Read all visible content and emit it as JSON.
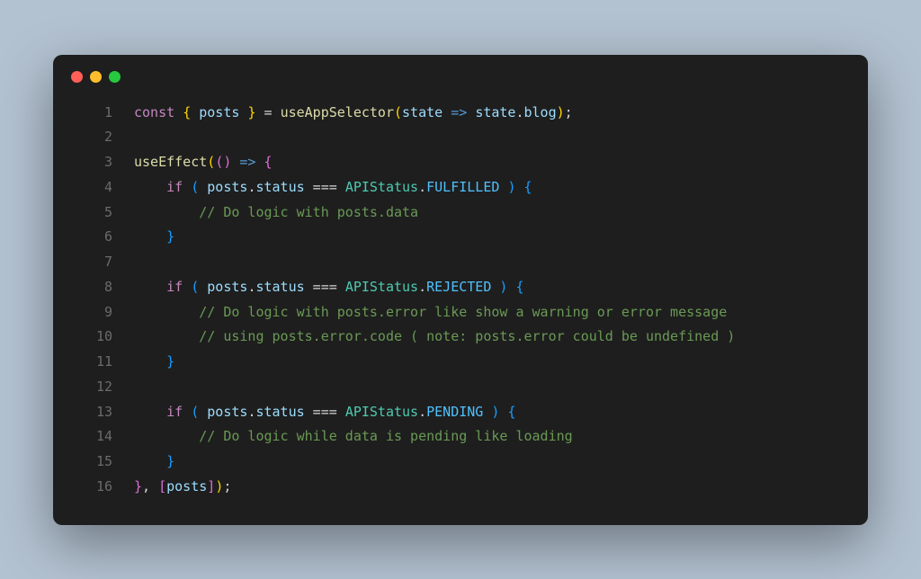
{
  "code": {
    "lines": [
      {
        "n": "1",
        "tokens": [
          {
            "t": "kw",
            "v": "const"
          },
          {
            "t": "punc",
            "v": " "
          },
          {
            "t": "brace",
            "v": "{"
          },
          {
            "t": "punc",
            "v": " "
          },
          {
            "t": "var",
            "v": "posts"
          },
          {
            "t": "punc",
            "v": " "
          },
          {
            "t": "brace",
            "v": "}"
          },
          {
            "t": "punc",
            "v": " = "
          },
          {
            "t": "fn",
            "v": "useAppSelector"
          },
          {
            "t": "brace",
            "v": "("
          },
          {
            "t": "var",
            "v": "state"
          },
          {
            "t": "punc",
            "v": " "
          },
          {
            "t": "arrow",
            "v": "=>"
          },
          {
            "t": "punc",
            "v": " "
          },
          {
            "t": "var",
            "v": "state"
          },
          {
            "t": "punc",
            "v": "."
          },
          {
            "t": "prop",
            "v": "blog"
          },
          {
            "t": "brace",
            "v": ")"
          },
          {
            "t": "punc",
            "v": ";"
          }
        ]
      },
      {
        "n": "2",
        "tokens": []
      },
      {
        "n": "3",
        "tokens": [
          {
            "t": "fn",
            "v": "useEffect"
          },
          {
            "t": "brace",
            "v": "("
          },
          {
            "t": "brace2",
            "v": "()"
          },
          {
            "t": "punc",
            "v": " "
          },
          {
            "t": "arrow",
            "v": "=>"
          },
          {
            "t": "punc",
            "v": " "
          },
          {
            "t": "brace2",
            "v": "{"
          }
        ]
      },
      {
        "n": "4",
        "tokens": [
          {
            "t": "punc",
            "v": "    "
          },
          {
            "t": "kw",
            "v": "if"
          },
          {
            "t": "punc",
            "v": " "
          },
          {
            "t": "brace3",
            "v": "("
          },
          {
            "t": "punc",
            "v": " "
          },
          {
            "t": "var",
            "v": "posts"
          },
          {
            "t": "punc",
            "v": "."
          },
          {
            "t": "prop",
            "v": "status"
          },
          {
            "t": "punc",
            "v": " === "
          },
          {
            "t": "cls",
            "v": "APIStatus"
          },
          {
            "t": "punc",
            "v": "."
          },
          {
            "t": "const",
            "v": "FULFILLED"
          },
          {
            "t": "punc",
            "v": " "
          },
          {
            "t": "brace3",
            "v": ")"
          },
          {
            "t": "punc",
            "v": " "
          },
          {
            "t": "brace3",
            "v": "{"
          }
        ]
      },
      {
        "n": "5",
        "tokens": [
          {
            "t": "punc",
            "v": "        "
          },
          {
            "t": "cmt",
            "v": "// Do logic with posts.data"
          }
        ]
      },
      {
        "n": "6",
        "tokens": [
          {
            "t": "punc",
            "v": "    "
          },
          {
            "t": "brace3",
            "v": "}"
          }
        ]
      },
      {
        "n": "7",
        "tokens": []
      },
      {
        "n": "8",
        "tokens": [
          {
            "t": "punc",
            "v": "    "
          },
          {
            "t": "kw",
            "v": "if"
          },
          {
            "t": "punc",
            "v": " "
          },
          {
            "t": "brace3",
            "v": "("
          },
          {
            "t": "punc",
            "v": " "
          },
          {
            "t": "var",
            "v": "posts"
          },
          {
            "t": "punc",
            "v": "."
          },
          {
            "t": "prop",
            "v": "status"
          },
          {
            "t": "punc",
            "v": " === "
          },
          {
            "t": "cls",
            "v": "APIStatus"
          },
          {
            "t": "punc",
            "v": "."
          },
          {
            "t": "const",
            "v": "REJECTED"
          },
          {
            "t": "punc",
            "v": " "
          },
          {
            "t": "brace3",
            "v": ")"
          },
          {
            "t": "punc",
            "v": " "
          },
          {
            "t": "brace3",
            "v": "{"
          }
        ]
      },
      {
        "n": "9",
        "tokens": [
          {
            "t": "punc",
            "v": "        "
          },
          {
            "t": "cmt",
            "v": "// Do logic with posts.error like show a warning or error message"
          }
        ]
      },
      {
        "n": "10",
        "tokens": [
          {
            "t": "punc",
            "v": "        "
          },
          {
            "t": "cmt",
            "v": "// using posts.error.code ( note: posts.error could be undefined )"
          }
        ]
      },
      {
        "n": "11",
        "tokens": [
          {
            "t": "punc",
            "v": "    "
          },
          {
            "t": "brace3",
            "v": "}"
          }
        ]
      },
      {
        "n": "12",
        "tokens": []
      },
      {
        "n": "13",
        "tokens": [
          {
            "t": "punc",
            "v": "    "
          },
          {
            "t": "kw",
            "v": "if"
          },
          {
            "t": "punc",
            "v": " "
          },
          {
            "t": "brace3",
            "v": "("
          },
          {
            "t": "punc",
            "v": " "
          },
          {
            "t": "var",
            "v": "posts"
          },
          {
            "t": "punc",
            "v": "."
          },
          {
            "t": "prop",
            "v": "status"
          },
          {
            "t": "punc",
            "v": " === "
          },
          {
            "t": "cls",
            "v": "APIStatus"
          },
          {
            "t": "punc",
            "v": "."
          },
          {
            "t": "const",
            "v": "PENDING"
          },
          {
            "t": "punc",
            "v": " "
          },
          {
            "t": "brace3",
            "v": ")"
          },
          {
            "t": "punc",
            "v": " "
          },
          {
            "t": "brace3",
            "v": "{"
          }
        ]
      },
      {
        "n": "14",
        "tokens": [
          {
            "t": "punc",
            "v": "        "
          },
          {
            "t": "cmt",
            "v": "// Do logic while data is pending like loading"
          }
        ]
      },
      {
        "n": "15",
        "tokens": [
          {
            "t": "punc",
            "v": "    "
          },
          {
            "t": "brace3",
            "v": "}"
          }
        ]
      },
      {
        "n": "16",
        "tokens": [
          {
            "t": "brace2",
            "v": "}"
          },
          {
            "t": "punc",
            "v": ", "
          },
          {
            "t": "brace2",
            "v": "["
          },
          {
            "t": "var",
            "v": "posts"
          },
          {
            "t": "brace2",
            "v": "]"
          },
          {
            "t": "brace",
            "v": ")"
          },
          {
            "t": "punc",
            "v": ";"
          }
        ]
      }
    ]
  }
}
